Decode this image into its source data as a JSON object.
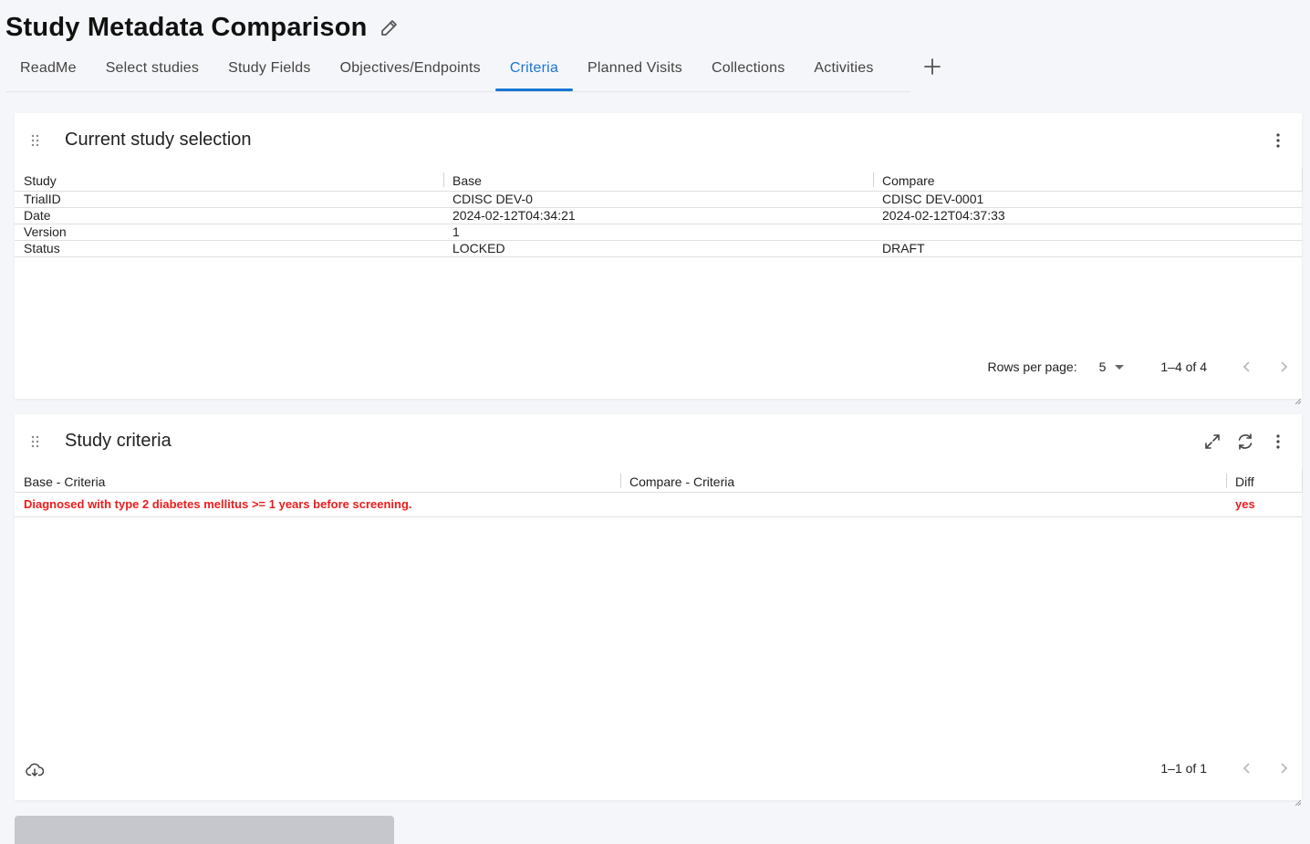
{
  "page": {
    "title": "Study Metadata Comparison"
  },
  "tabs": [
    {
      "label": "ReadMe"
    },
    {
      "label": "Select studies"
    },
    {
      "label": "Study Fields"
    },
    {
      "label": "Objectives/Endpoints"
    },
    {
      "label": "Criteria",
      "active": true
    },
    {
      "label": "Planned Visits"
    },
    {
      "label": "Collections"
    },
    {
      "label": "Activities"
    }
  ],
  "selection_card": {
    "title": "Current study selection",
    "columns": [
      "Study",
      "Base",
      "Compare"
    ],
    "rows": [
      [
        "TrialID",
        "CDISC DEV-0",
        "CDISC DEV-0001"
      ],
      [
        "Date",
        "2024-02-12T04:34:21",
        "2024-02-12T04:37:33"
      ],
      [
        "Version",
        "1",
        ""
      ],
      [
        "Status",
        "LOCKED",
        "DRAFT"
      ]
    ],
    "footer": {
      "rows_per_page_label": "Rows per page:",
      "rows_per_page_value": "5",
      "range": "1–4 of 4"
    }
  },
  "criteria_card": {
    "title": "Study criteria",
    "columns": [
      "Base - Criteria",
      "Compare - Criteria",
      "Diff"
    ],
    "rows": [
      [
        "Diagnosed with type 2 diabetes mellitus >= 1 years before screening.",
        "",
        "yes"
      ]
    ],
    "footer": {
      "range": "1–1 of 1"
    }
  },
  "colors": {
    "accent": "#1976d2",
    "diff_highlight": "#ee1c1c"
  },
  "icons": {
    "title": "pencil-edit-icon",
    "tab_add": "plus-icon",
    "drag": "drag-handle-icon",
    "menu": "more-vertical-icon",
    "expand": "expand-icon",
    "refresh": "refresh-icon",
    "download": "cloud-download-icon",
    "prev": "chevron-left-icon",
    "next": "chevron-right-icon"
  }
}
